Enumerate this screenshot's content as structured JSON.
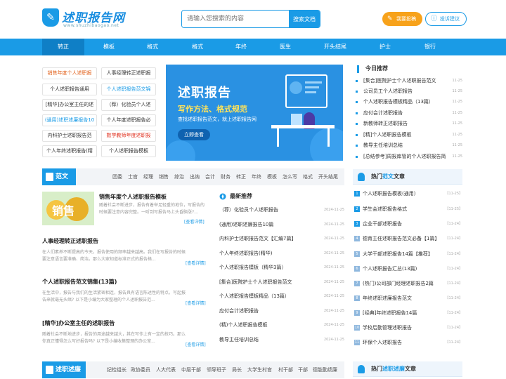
{
  "header": {
    "logo_title": "述职报告网",
    "logo_url_text": "www.shuzhibaogao.net",
    "search_placeholder": "请输入您搜索的内容",
    "search_button": "搜索文档",
    "submit_label": "我要投稿",
    "feedback_label": "投诉建议"
  },
  "nav": [
    "转正",
    "模板",
    "格式",
    "格式",
    "年终",
    "医生",
    "开头结尾",
    "护士",
    "银行"
  ],
  "tags": [
    "销售年度个人述职报",
    "人事经理转正述职报",
    "个人述职报告通用",
    "个人述职报告范文锦",
    "[精华]办公室主任的述",
    "（荐）化验员个人述",
    "(通用)述职述廉报告10",
    "个人年度述职报告必",
    "内科护士述职报告范",
    "数学教师年度述职报",
    "个人年终述职报告(精",
    "个人述职报告模板"
  ],
  "banner": {
    "title": "述职报告",
    "subtitle": "写作方法、格式规范",
    "desc": "查找述职报告范文，就上述职报告网",
    "button": "立即查看"
  },
  "today": {
    "title": "今日推荐",
    "items": [
      {
        "t": "[集合]医院护士个人述职报告范文",
        "d": "11-25"
      },
      {
        "t": "公司员工个人述职报告",
        "d": "11-25"
      },
      {
        "t": "个人述职报告模板精品（13篇）",
        "d": "11-25"
      },
      {
        "t": "应付会计述职报告",
        "d": "11-25"
      },
      {
        "t": "新教师转正述职报告",
        "d": "11-25"
      },
      {
        "t": "[精]个人述职报告模板",
        "d": "11-25"
      },
      {
        "t": "教导主任培训总结",
        "d": "11-25"
      },
      {
        "t": "[总结参考]周报库管的个人述职报告简",
        "d": "11-25"
      }
    ]
  },
  "fanwen": {
    "label": "范文",
    "links": [
      "团委",
      "士官",
      "经理",
      "销售",
      "综治",
      "出纳",
      "会计",
      "财务",
      "转正",
      "年终",
      "模板",
      "怎么写",
      "格式",
      "开头结尾"
    ]
  },
  "feature": {
    "img_text": "销售",
    "title": "销售年度个人述职报告模板",
    "desc": "随着社会不断进步，报告有着举足轻重的地位，写报告的时候要注意内容完整。一听到写报告马上头昏脑涨?...",
    "more": "[查看详情]"
  },
  "articles": [
    {
      "title": "人事经理转正述职报告",
      "desc": "在人们素养不断提高的今天，报告使用的频率越来越高。我们在写报告的时候要注意语言要准确、简洁。那么大家知道标准正式的报告格...",
      "more": "[查看详情]"
    },
    {
      "title": "个人述职报告范文锦集(13篇)",
      "desc": "在生活中，报告与我们的生活紧密相连，报告具有语言陈述性的特点。写起报告来就毫无头绪? 以下是小编为大家整理的个人述职报告范...",
      "more": "[查看详情]"
    },
    {
      "title": "[精华]办公室主任的述职报告",
      "desc": "随着社会不断地进步，报告的用途越来越大，其在写作上有一定的技巧。那么你真正懂得怎么写好报告吗? 以下是小编收集整理的办公室...",
      "more": "[查看详情]"
    }
  ],
  "newrec": {
    "title": "最新推荐",
    "items": [
      {
        "t": "（荐）化验员个人述职报告",
        "d": "2024-11-25"
      },
      {
        "t": "(通用)述职述廉报告10篇",
        "d": "2024-11-25"
      },
      {
        "t": "内科护士述职报告范文【汇编7篇】",
        "d": "2024-11-25"
      },
      {
        "t": "个人年终述职报告(精华)",
        "d": "2024-11-25"
      },
      {
        "t": "个人述职报告模板（精华3篇）",
        "d": "2024-11-25"
      },
      {
        "t": "[集合]医院护士个人述职报告范文",
        "d": "2024-11-25"
      },
      {
        "t": "个人述职报告模板精品（13篇）",
        "d": "2024-11-25"
      },
      {
        "t": "应付会计述职报告",
        "d": "2024-11-25"
      },
      {
        "t": "(精)个人述职报告模板",
        "d": "2024-11-25"
      },
      {
        "t": "教导主任培训总结",
        "d": "2024-11-25"
      }
    ]
  },
  "hot1": {
    "title_a": "热门",
    "title_b": "范文",
    "title_c": "文章",
    "items": [
      {
        "t": "个人述职报告模板(通用)",
        "d": "【11-25】"
      },
      {
        "t": "学生会述职报告格式",
        "d": "【11-25】"
      },
      {
        "t": "企业干部述职报告",
        "d": "【11-24】"
      },
      {
        "t": "德育主任述职报告范文必备【1篇】",
        "d": "【11-24】"
      },
      {
        "t": "大学干部述职报告14篇【推荐】",
        "d": "【11-24】"
      },
      {
        "t": "个人述职报告汇总(13篇)",
        "d": "【11-24】"
      },
      {
        "t": "(热门)公司部门经理述职报告2篇",
        "d": "【11-24】"
      },
      {
        "t": "年终述职述廉报告范文",
        "d": "【11-24】"
      },
      {
        "t": "[经典]年终述职报告14篇",
        "d": "【11-24】"
      },
      {
        "t": "学校后勤管理述职报告",
        "d": "【11-24】"
      },
      {
        "t": "环保个人述职报告",
        "d": "【11-24】"
      }
    ]
  },
  "shulian": {
    "label": "述职述廉",
    "links": [
      "纪检组长",
      "政协委员",
      "人大代表",
      "中层干部",
      "领导班子",
      "局长",
      "大学生村官",
      "村干部",
      "干部",
      "德能勤绩廉"
    ]
  },
  "hot2": {
    "title_a": "热门",
    "title_b": "述职述廉",
    "title_c": "文章"
  },
  "colors": {
    "primary": "#1a9be6",
    "accent": "#f7a21b",
    "banner": "#2a91e2",
    "highlight": "#ffe35a"
  }
}
